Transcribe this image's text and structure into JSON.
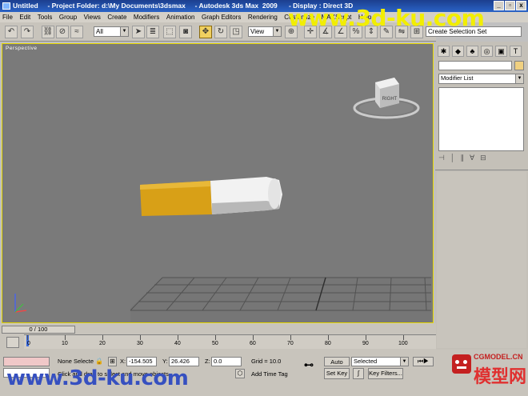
{
  "titlebar": {
    "text": "Untitled     - Project Folder: d:\\My Documents\\3dsmax     - Autodesk 3ds Max  2009      - Display : Direct 3D",
    "minimize": "_",
    "restore": "▫",
    "close": "x"
  },
  "menu": [
    "File",
    "Edit",
    "Tools",
    "Group",
    "Views",
    "Create",
    "Modifiers",
    "Animation",
    "Graph Editors",
    "Rendering",
    "Customize",
    "MAXScript",
    "Help"
  ],
  "toolbar": {
    "selection_filter": "All",
    "ref_coord": "View",
    "named_selection": "Create Selection Set"
  },
  "watermark_top": "www.3d-ku.com",
  "viewport": {
    "label": "Perspective",
    "viewcube_face": "RIGHT",
    "colors": {
      "background": "#7a7a7a",
      "filter": "#d8a017",
      "paper": "#f2f2f2",
      "grid": "#525252",
      "border": "#e8d800"
    }
  },
  "command_panel": {
    "modifier_list": "Modifier List",
    "tab_icons": [
      "create-icon",
      "modify-icon",
      "hierarchy-icon",
      "motion-icon",
      "display-icon",
      "utilities-icon"
    ]
  },
  "timeline": {
    "slider_label": "0 / 100",
    "ticks": [
      "0",
      "10",
      "20",
      "30",
      "40",
      "50",
      "60",
      "70",
      "80",
      "90",
      "100"
    ]
  },
  "status": {
    "maxscript_listener": "",
    "selection": "None Selecte",
    "x_label": "X:",
    "x_value": "-154.505",
    "y_label": "Y:",
    "y_value": "26.426",
    "z_label": "Z:",
    "z_value": "0.0",
    "grid": "Grid = 10.0",
    "prompt": "Click and drag to select and move objects",
    "add_time_tag": "Add Time Tag",
    "auto_key": "Auto Key",
    "set_key": "Set Key",
    "key_mode": "Selected",
    "key_filters": "Key Filters..."
  },
  "watermark_bottom": "www.3d-ku.com",
  "cgmodel": {
    "url": "CGMODEL.CN",
    "name": "模型网"
  }
}
